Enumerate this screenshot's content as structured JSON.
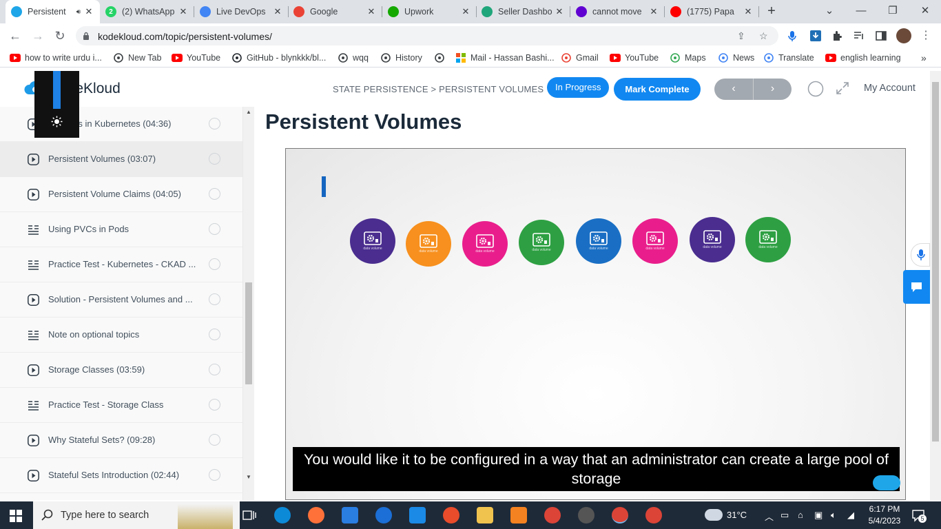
{
  "browser": {
    "tabs": [
      {
        "title": "Persistent",
        "active": true,
        "audio": true,
        "color": "#1ea6e8"
      },
      {
        "title": "(2) WhatsApp",
        "color": "#25d366",
        "badge": "2"
      },
      {
        "title": "Live DevOps",
        "color": "#4285f4"
      },
      {
        "title": "Google",
        "color": "#ea4335"
      },
      {
        "title": "Upwork",
        "color": "#14a800"
      },
      {
        "title": "Seller Dashbo",
        "color": "#1fa67a"
      },
      {
        "title": "cannot move",
        "color": "#6001d2"
      },
      {
        "title": "(1775) Papa",
        "color": "#ff0000"
      }
    ],
    "new_tab": "+",
    "url": "kodekloud.com/topic/persistent-volumes/",
    "bookmarks": [
      {
        "label": "how to write urdu i...",
        "icon": "youtube-icon"
      },
      {
        "label": "New Tab",
        "icon": "globe-icon"
      },
      {
        "label": "YouTube",
        "icon": "youtube-icon"
      },
      {
        "label": "GitHub - blynkkk/bl...",
        "icon": "github-icon"
      },
      {
        "label": "wqq",
        "icon": "download-icon"
      },
      {
        "label": "History",
        "icon": "history-icon"
      },
      {
        "label": "",
        "icon": "globe-icon"
      },
      {
        "label": "Mail - Hassan Bashi...",
        "icon": "microsoft-icon"
      },
      {
        "label": "Gmail",
        "icon": "gmail-icon"
      },
      {
        "label": "YouTube",
        "icon": "youtube-icon"
      },
      {
        "label": "Maps",
        "icon": "maps-icon"
      },
      {
        "label": "News",
        "icon": "news-icon"
      },
      {
        "label": "Translate",
        "icon": "translate-icon"
      },
      {
        "label": "english learning",
        "icon": "youtube-icon"
      }
    ],
    "more_bookmarks": "»"
  },
  "header": {
    "logo_text": "KodeKloud",
    "breadcrumb": "STATE PERSISTENCE > PERSISTENT VOLUMES",
    "in_progress": "In Progress",
    "mark_complete": "Mark Complete",
    "prev": "‹",
    "next": "›",
    "account": "My Account"
  },
  "sidebar": {
    "lessons": [
      {
        "title": "Volumes in Kubernetes (04:36)",
        "type": "video"
      },
      {
        "title": "Persistent Volumes (03:07)",
        "type": "video",
        "current": true
      },
      {
        "title": "Persistent Volume Claims (04:05)",
        "type": "video"
      },
      {
        "title": "Using PVCs in Pods",
        "type": "text"
      },
      {
        "title": "Practice Test - Kubernetes - CKAD ...",
        "type": "text"
      },
      {
        "title": "Solution - Persistent Volumes and ...",
        "type": "video"
      },
      {
        "title": "Note on optional topics",
        "type": "text"
      },
      {
        "title": "Storage Classes (03:59)",
        "type": "video"
      },
      {
        "title": "Practice Test - Storage Class",
        "type": "text"
      },
      {
        "title": "Why Stateful Sets? (09:28)",
        "type": "video"
      },
      {
        "title": "Stateful Sets Introduction (02:44)",
        "type": "video"
      }
    ]
  },
  "main": {
    "title": "Persistent Volumes",
    "volume_label": "data volume",
    "volumes": [
      "#4a2d8f",
      "#f7901e",
      "#e91e8c",
      "#2ea043",
      "#1a6fc4",
      "#e91e8c",
      "#4a2d8f",
      "#2ea043"
    ],
    "caption": "You would like it to be configured in a way that an administrator can create a large pool of storage"
  },
  "taskbar": {
    "search_placeholder": "Type here to search",
    "weather": "31°C",
    "time": "6:17 PM",
    "date": "5/4/2023",
    "notifications": "5"
  }
}
